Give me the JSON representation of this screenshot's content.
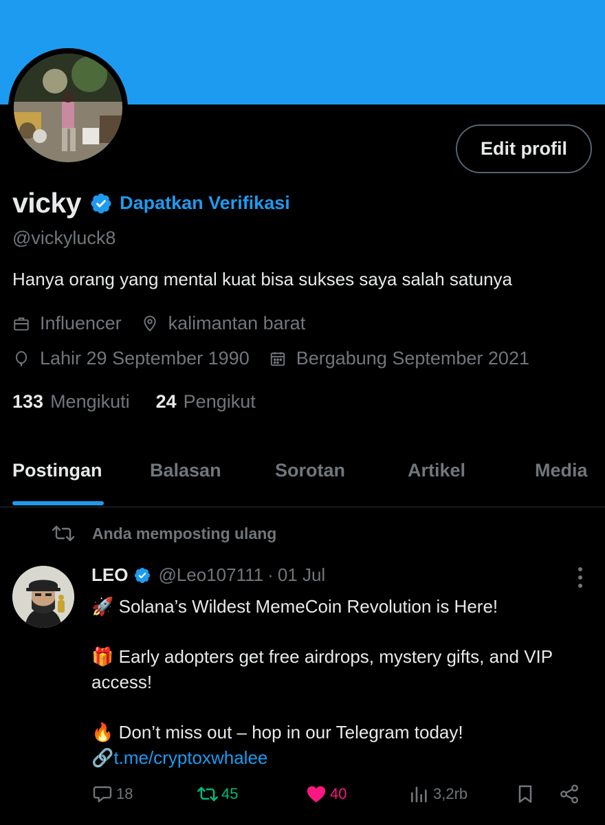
{
  "profile": {
    "name": "vicky",
    "get_verified": "Dapatkan Verifikasi",
    "handle": "@vickyluck8",
    "bio": "Hanya orang yang mental kuat bisa sukses saya salah satunya",
    "category": "Influencer",
    "location": "kalimantan barat",
    "birth": "Lahir 29 September 1990",
    "joined": "Bergabung September 2021",
    "following_count": "133",
    "following_label": "Mengikuti",
    "followers_count": "24",
    "followers_label": "Pengikut",
    "edit_button": "Edit profil"
  },
  "tabs": [
    {
      "label": "Postingan",
      "active": true
    },
    {
      "label": "Balasan"
    },
    {
      "label": "Sorotan"
    },
    {
      "label": "Artikel"
    },
    {
      "label": "Media"
    }
  ],
  "post": {
    "repost_label": "Anda memposting ulang",
    "author_name": "LEO",
    "author_handle": "@Leo107111",
    "separator": "·",
    "date": "01 Jul",
    "line1": "🚀 Solana’s Wildest MemeCoin Revolution is Here!",
    "line2": "🎁 Early adopters get free airdrops, mystery gifts, and VIP access!",
    "line3": "🔥 Don’t miss out – hop in our Telegram today!",
    "link_emoji": "🔗",
    "link": "t.me/cryptoxwhalee",
    "replies": "18",
    "reposts": "45",
    "likes": "40",
    "views": "3,2rb"
  },
  "colors": {
    "accent": "#1d9bf0",
    "repost_green": "#00ba7c",
    "like_pink": "#f91880",
    "muted": "#71767b"
  },
  "icons": [
    "briefcase-icon",
    "location-pin-icon",
    "balloon-icon",
    "calendar-icon",
    "repost-icon",
    "reply-icon",
    "like-icon",
    "views-icon",
    "bookmark-icon",
    "share-icon",
    "more-icon",
    "verified-badge-icon"
  ]
}
